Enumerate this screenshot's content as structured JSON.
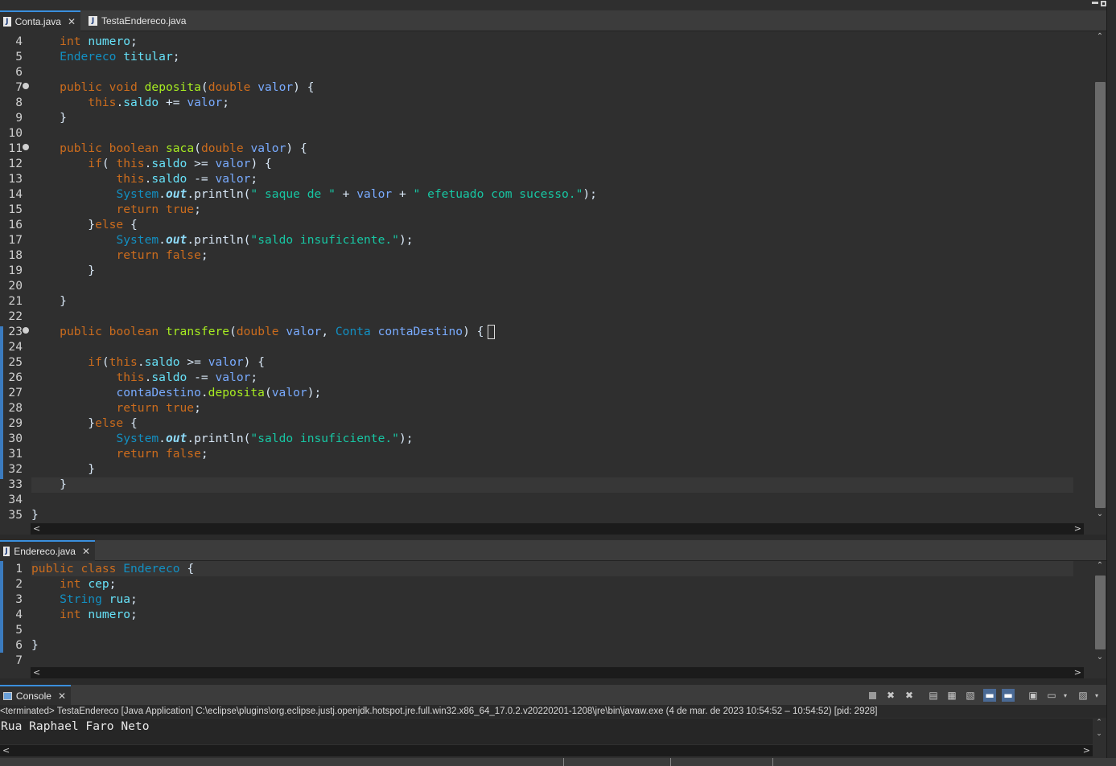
{
  "editor_top": {
    "tabs": [
      {
        "label": "Conta.java",
        "close": "✕"
      },
      {
        "label": "TestaEndereco.java"
      }
    ],
    "lines": [
      {
        "n": "4",
        "text": "    int numero;"
      },
      {
        "n": "5",
        "text": "    Endereco titular;"
      },
      {
        "n": "6",
        "text": ""
      },
      {
        "n": "7",
        "text": "    public void deposita(double valor) {"
      },
      {
        "n": "8",
        "text": "        this.saldo += valor;"
      },
      {
        "n": "9",
        "text": "    }"
      },
      {
        "n": "10",
        "text": ""
      },
      {
        "n": "11",
        "text": "    public boolean saca(double valor) {"
      },
      {
        "n": "12",
        "text": "        if( this.saldo >= valor) {"
      },
      {
        "n": "13",
        "text": "            this.saldo -= valor;"
      },
      {
        "n": "14",
        "text": "            System.out.println(\" saque de \" + valor + \" efetuado com sucesso.\");"
      },
      {
        "n": "15",
        "text": "            return true;"
      },
      {
        "n": "16",
        "text": "        }else {"
      },
      {
        "n": "17",
        "text": "            System.out.println(\"saldo insuficiente.\");"
      },
      {
        "n": "18",
        "text": "            return false;"
      },
      {
        "n": "19",
        "text": "        }"
      },
      {
        "n": "20",
        "text": ""
      },
      {
        "n": "21",
        "text": "    }"
      },
      {
        "n": "22",
        "text": ""
      },
      {
        "n": "23",
        "text": "    public boolean transfere(double valor, Conta contaDestino) {"
      },
      {
        "n": "24",
        "text": ""
      },
      {
        "n": "25",
        "text": "        if(this.saldo >= valor) {"
      },
      {
        "n": "26",
        "text": "            this.saldo -= valor;"
      },
      {
        "n": "27",
        "text": "            contaDestino.deposita(valor);"
      },
      {
        "n": "28",
        "text": "            return true;"
      },
      {
        "n": "29",
        "text": "        }else {"
      },
      {
        "n": "30",
        "text": "            System.out.println(\"saldo insuficiente.\");"
      },
      {
        "n": "31",
        "text": "            return false;"
      },
      {
        "n": "32",
        "text": "        }"
      },
      {
        "n": "33",
        "text": "    }"
      },
      {
        "n": "34",
        "text": ""
      },
      {
        "n": "35",
        "text": "}"
      }
    ]
  },
  "editor_bottom": {
    "tabs": [
      {
        "label": "Endereco.java",
        "close": "✕"
      }
    ],
    "lines": [
      {
        "n": "1",
        "text": "public class Endereco {"
      },
      {
        "n": "2",
        "text": "    int cep;"
      },
      {
        "n": "3",
        "text": "    String rua;"
      },
      {
        "n": "4",
        "text": "    int numero;"
      },
      {
        "n": "5",
        "text": ""
      },
      {
        "n": "6",
        "text": "}"
      },
      {
        "n": "7",
        "text": ""
      }
    ]
  },
  "console": {
    "tab_label": "Console",
    "close": "✕",
    "terminated": "<terminated> TestaEndereco [Java Application] C:\\eclipse\\plugins\\org.eclipse.justj.openjdk.hotspot.jre.full.win32.x86_64_17.0.2.v20220201-1208\\jre\\bin\\javaw.exe  (4 de mar. de 2023 10:54:52 – 10:54:52) [pid: 2928]",
    "output": "Rua Raphael Faro Neto"
  },
  "icons": {
    "java_file": "J",
    "scroll_up": "⌃",
    "scroll_down": "⌄",
    "scroll_left": "<",
    "scroll_right": ">"
  }
}
